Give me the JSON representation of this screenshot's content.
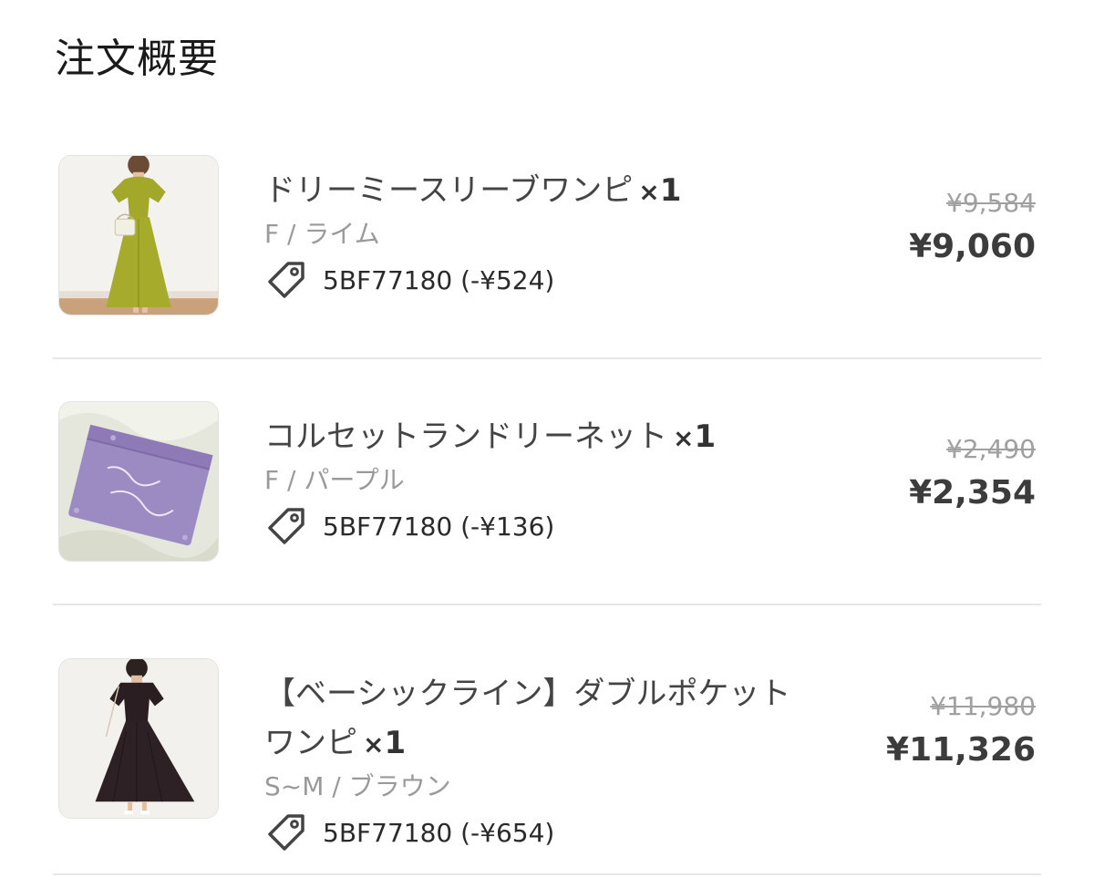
{
  "page": {
    "title": "注文概要"
  },
  "items": [
    {
      "name": "ドリーミースリーブワンピ",
      "qty_prefix": "×",
      "qty": "1",
      "variant": "F / ライム",
      "coupon": "5BF77180 (-¥524)",
      "price_original": "¥9,584",
      "price_final": "¥9,060",
      "thumbnail": "lime-dress-photo"
    },
    {
      "name": "コルセットランドリーネット",
      "qty_prefix": "×",
      "qty": "1",
      "variant": "F / パープル",
      "coupon": "5BF77180 (-¥136)",
      "price_original": "¥2,490",
      "price_final": "¥2,354",
      "thumbnail": "purple-laundry-net-photo"
    },
    {
      "name_line1": "【ベーシックライン】ダブルポケット",
      "name_line2": "ワンピ",
      "qty_prefix": "×",
      "qty": "1",
      "variant": "S~M / ブラウン",
      "coupon": "5BF77180 (-¥654)",
      "price_original": "¥11,980",
      "price_final": "¥11,326",
      "thumbnail": "brown-dress-photo"
    }
  ],
  "icons": {
    "coupon": "tag-icon"
  },
  "colors": {
    "text_primary": "#333333",
    "text_secondary": "#9a9a9a",
    "strikethrough": "#a0a0a0",
    "divider": "#e6e6e6"
  }
}
